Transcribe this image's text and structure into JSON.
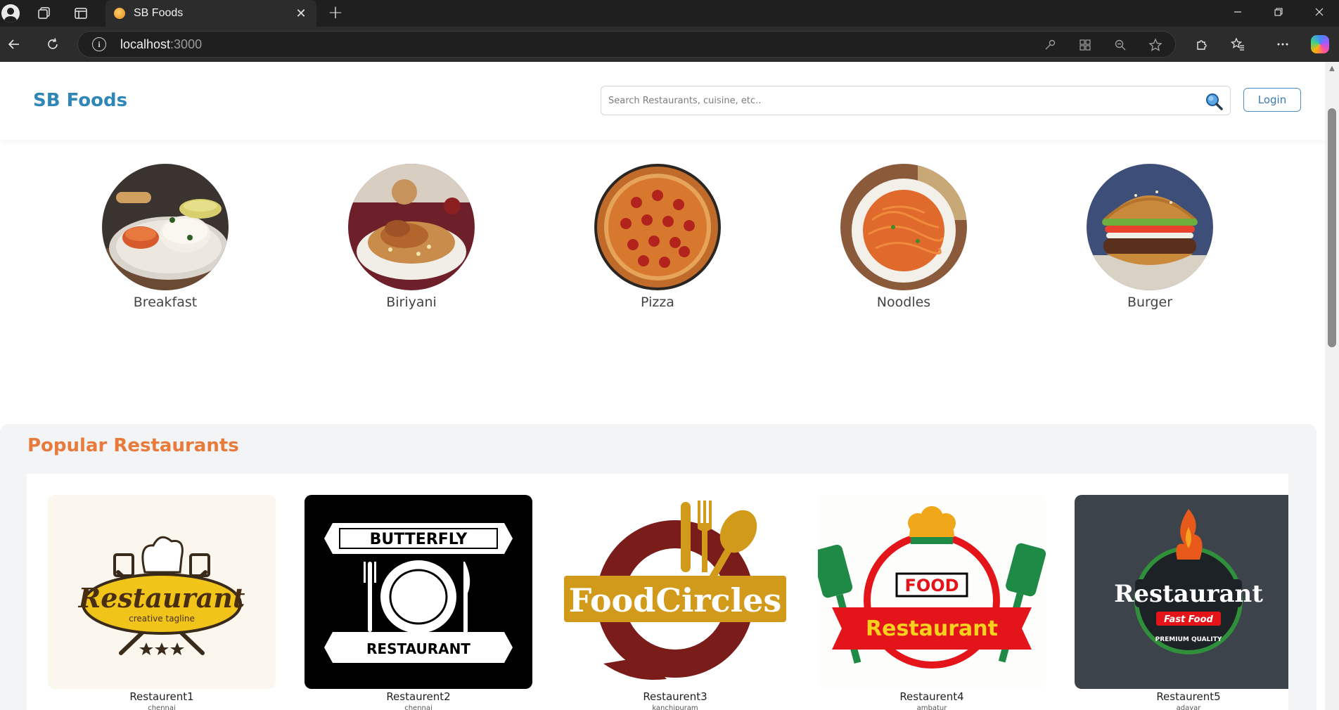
{
  "browser": {
    "tab_title": "SB Foods",
    "tab_close": "✕",
    "new_tab": "+",
    "url_host": "localhost",
    "url_port": ":3000"
  },
  "header": {
    "logo": "SB Foods",
    "search_placeholder": "Search Restaurants, cuisine, etc..",
    "login_label": "Login"
  },
  "categories": [
    {
      "label": "Breakfast"
    },
    {
      "label": "Biriyani"
    },
    {
      "label": "Pizza"
    },
    {
      "label": "Noodles"
    },
    {
      "label": "Burger"
    }
  ],
  "popular": {
    "title": "Popular Restaurants",
    "restaurants": [
      {
        "name": "Restaurent1",
        "location": "chennai",
        "logo_text": "Restaurant",
        "logo_sub": "creative tagline"
      },
      {
        "name": "Restaurent2",
        "location": "chennai",
        "logo_top": "BUTTERFLY",
        "logo_bottom": "RESTAURANT"
      },
      {
        "name": "Restaurent3",
        "location": "kanchipuram",
        "logo_text": "FoodCircles"
      },
      {
        "name": "Restaurent4",
        "location": "ambatur",
        "logo_top": "FOOD",
        "logo_text": "Restaurant"
      },
      {
        "name": "Restaurent5",
        "location": "adayar",
        "logo_text": "Restaurant",
        "logo_sub": "Fast Food",
        "logo_ring": "PREMIUM QUALITY"
      }
    ]
  },
  "colors": {
    "brand": "#2f86b8",
    "accent": "#e87a3c",
    "login_border": "#4c8fc4"
  }
}
